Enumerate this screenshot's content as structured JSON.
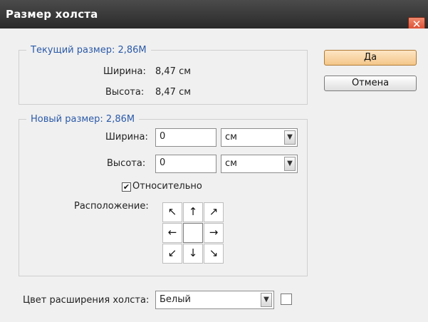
{
  "window": {
    "title": "Размер холста",
    "close_symbol": "✕"
  },
  "current_size": {
    "legend": "Текущий размер: 2,86M",
    "width_label": "Ширина:",
    "width_value": "8,47 см",
    "height_label": "Высота:",
    "height_value": "8,47 см"
  },
  "new_size": {
    "legend": "Новый размер: 2,86M",
    "width_label": "Ширина:",
    "width_value": "0",
    "width_unit": "см",
    "height_label": "Высота:",
    "height_value": "0",
    "height_unit": "см",
    "relative_checked": true,
    "relative_label": "Относительно",
    "anchor_label": "Расположение:",
    "anchor_arrows": [
      "↖",
      "↑",
      "↗",
      "←",
      "",
      "→",
      "↙",
      "↓",
      "↘"
    ]
  },
  "buttons": {
    "ok": "Да",
    "cancel": "Отмена"
  },
  "canvas_extension": {
    "label": "Цвет расширения холста:",
    "value": "Белый",
    "swatch_color": "#ffffff"
  }
}
